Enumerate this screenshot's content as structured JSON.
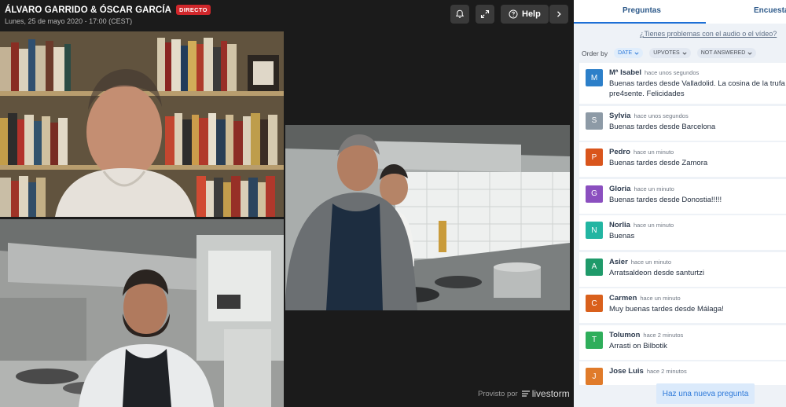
{
  "header": {
    "title": "ÁLVARO GARRIDO & ÓSCAR GARCÍA",
    "live_badge": "DIRECTO",
    "date": "Lunes, 25 de mayo 2020 - 17:00 (CEST)",
    "help_label": "Help"
  },
  "icons": {
    "bell": "bell-icon",
    "fullscreen": "fullscreen-icon",
    "help": "question-icon",
    "next": "chevron-right-icon"
  },
  "footer": {
    "powered_by": "Provisto por",
    "brand": "livestorm"
  },
  "panel": {
    "tabs": [
      {
        "label": "Preguntas",
        "active": true
      },
      {
        "label": "Encuestas",
        "active": false
      }
    ],
    "audio_help": "¿Tienes problemas con el audio o el vídeo?",
    "order_by": "Order by",
    "filters": [
      {
        "label": "DATE",
        "active": true
      },
      {
        "label": "UPVOTES",
        "active": false
      },
      {
        "label": "NOT ANSWERED",
        "active": false
      }
    ],
    "questions": [
      {
        "initial": "M",
        "name": "Mª Isabel",
        "time": "hace unos segundos",
        "text": "Buenas tardes desde Valladolid. La cosina de la trufa pre4sente. Felicidades",
        "color": "#2c7fc9"
      },
      {
        "initial": "S",
        "name": "Sylvia",
        "time": "hace unos segundos",
        "text": "Buenas tardes desde Barcelona",
        "color": "#8d9aa6"
      },
      {
        "initial": "P",
        "name": "Pedro",
        "time": "hace un minuto",
        "text": "Buenas tardes desde Zamora",
        "color": "#d9551c"
      },
      {
        "initial": "G",
        "name": "Gloria",
        "time": "hace un minuto",
        "text": "Buenas tardes desde Donostia!!!!!",
        "color": "#8b4fbf"
      },
      {
        "initial": "N",
        "name": "Norlia",
        "time": "hace un minuto",
        "text": "Buenas",
        "color": "#22b5a2"
      },
      {
        "initial": "A",
        "name": "Asier",
        "time": "hace un minuto",
        "text": "Arratsaldeon desde santurtzi",
        "color": "#1f9a6a"
      },
      {
        "initial": "C",
        "name": "Carmen",
        "time": "hace un minuto",
        "text": "Muy buenas tardes desde Málaga!",
        "color": "#d9601c"
      },
      {
        "initial": "T",
        "name": "Tolumon",
        "time": "hace 2 minutos",
        "text": "Arrasti on Bilbotik",
        "color": "#2fae5b"
      },
      {
        "initial": "J",
        "name": "Jose Luis",
        "time": "hace 2 minutos",
        "text": "",
        "color": "#e07b2a"
      }
    ],
    "ask_button": "Haz una nueva pregunta"
  }
}
